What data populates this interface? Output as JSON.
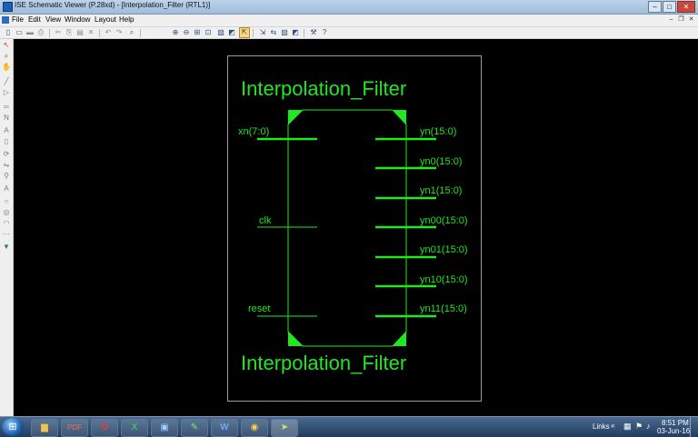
{
  "window": {
    "title": "ISE Schematic Viewer (P.28xd) - [Interpolation_Filter (RTL1)]",
    "app_icon": "ise-app-icon",
    "controls": {
      "minimize": "–",
      "maximize": "□",
      "close": "✕"
    }
  },
  "menubar": {
    "items": [
      "File",
      "Edit",
      "View",
      "Window",
      "Layout",
      "Help"
    ],
    "mdi_controls": {
      "minimize": "–",
      "restore": "❐",
      "close": "✕"
    }
  },
  "toolbar": {
    "icons": [
      "new-file-icon",
      "open-folder-icon",
      "save-icon",
      "print-icon",
      "cut-icon",
      "copy-icon",
      "paste-icon",
      "delete-icon",
      "undo-icon",
      "redo-icon",
      "find-icon",
      "zoom-in-icon",
      "zoom-out-icon",
      "zoom-full-icon",
      "zoom-selected-icon",
      "select-icon",
      "schematic-view-icon",
      "expand-icon",
      "collapse-icon",
      "show-nets-icon",
      "properties-icon",
      "help-icon"
    ],
    "glyphs": [
      "▯",
      "▭",
      "▬",
      "⎙",
      "✂",
      "⎘",
      "▤",
      "✕",
      "↶",
      "↷",
      "⌕",
      "⊕",
      "⊖",
      "⊞",
      "⊡",
      "▧",
      "◩",
      "⇱",
      "⇲",
      "⇆",
      "⚒",
      "?"
    ]
  },
  "sidebar": {
    "icons": [
      "select-arrow-icon",
      "zoom-tool-icon",
      "pan-tool-icon",
      "add-wire-icon",
      "add-pin-icon",
      "add-bus-icon",
      "add-net-name-icon",
      "add-text-icon",
      "add-symbol-icon",
      "rotate-icon",
      "mirror-icon",
      "text-annotation-icon",
      "marker-icon",
      "circle-tool-icon",
      "ellipse-tool-icon",
      "arc-tool-icon",
      "grid-icon",
      "hierarchy-icon"
    ],
    "glyphs": [
      "↖",
      "⌕",
      "✋",
      "╱",
      "▷",
      "═",
      "N",
      "A",
      "▯",
      "⟳",
      "⇋",
      "A",
      "⚲",
      "○",
      "◎",
      "◠",
      "⋯",
      "▼"
    ]
  },
  "schematic": {
    "title_top": "Interpolation_Filter",
    "title_bottom": "Interpolation_Filter",
    "inputs": [
      "xn(7:0)",
      "clk",
      "reset"
    ],
    "outputs": [
      "yn(15:0)",
      "yn0(15:0)",
      "yn1(15:0)",
      "yn00(15:0)",
      "yn01(15:0)",
      "yn10(15:0)",
      "yn11(15:0)"
    ],
    "colors": {
      "symbol": "#1fe81f",
      "canvas": "#000000",
      "sheet_border": "#9a9a9a"
    }
  },
  "taskbar": {
    "start_glyph": "⊞",
    "apps": [
      "folder-icon",
      "pdf-icon",
      "opera-icon",
      "excel-icon",
      "image-viewer-icon",
      "ise-tool-icon",
      "word-icon",
      "media-player-icon",
      "arrow-app-icon"
    ],
    "app_glyphs": [
      "▆",
      "PDF",
      "O",
      "X",
      "▣",
      "✎",
      "W",
      "◉",
      "➤"
    ],
    "tray_links": "Links",
    "time": "8:51 PM",
    "date": "03-Jun-16"
  }
}
